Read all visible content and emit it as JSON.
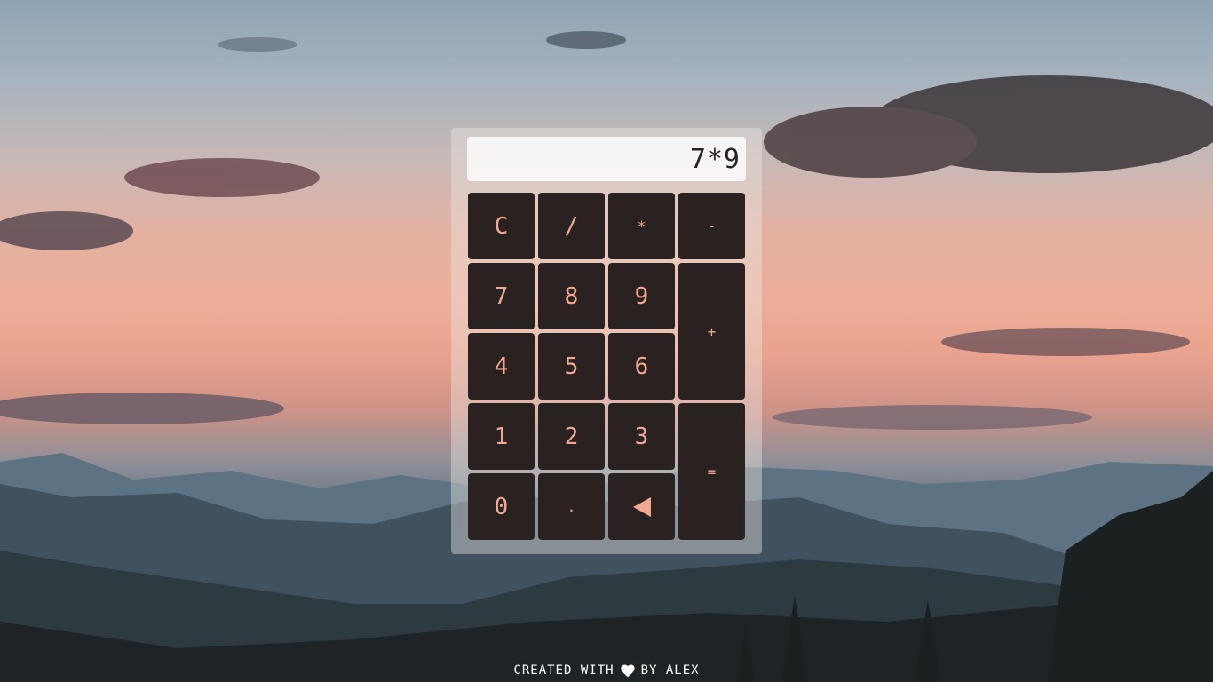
{
  "display": {
    "value": "7*9"
  },
  "keys": {
    "clear": "C",
    "divide": "/",
    "multiply": "*",
    "minus": "-",
    "seven": "7",
    "eight": "8",
    "nine": "9",
    "plus": "+",
    "four": "4",
    "five": "5",
    "six": "6",
    "one": "1",
    "two": "2",
    "three": "3",
    "equals": "=",
    "zero": "0",
    "dot": "."
  },
  "footer": {
    "prefix": "CREATED WITH",
    "suffix": "BY ALEX",
    "icon": "heart-icon"
  },
  "colors": {
    "key_bg": "#2a2220",
    "key_text": "#f0a893",
    "panel": "rgba(235,230,226,0.42)"
  }
}
